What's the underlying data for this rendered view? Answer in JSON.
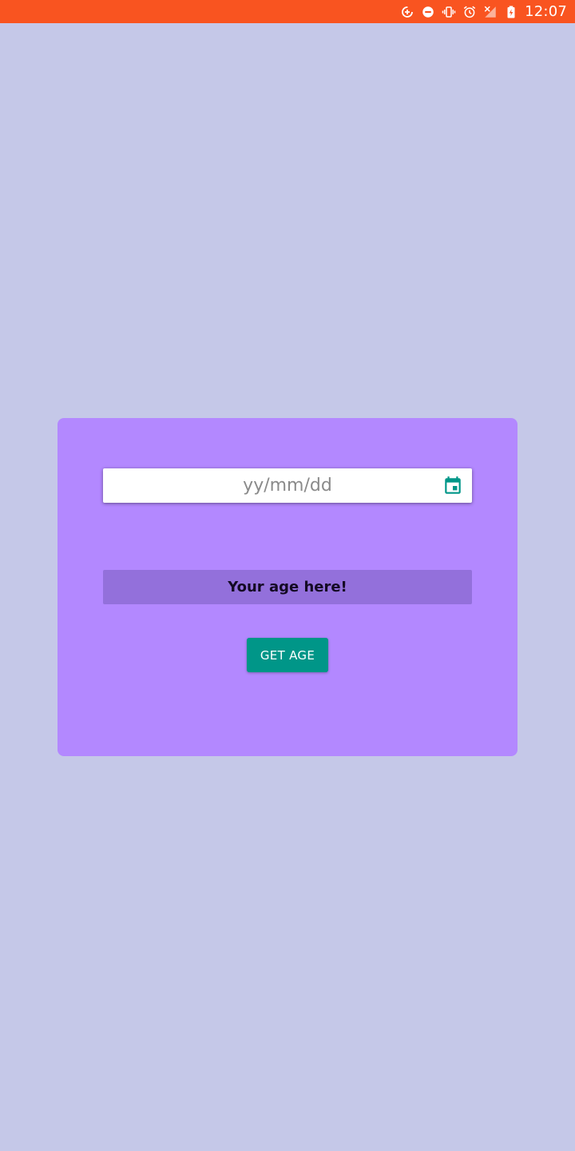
{
  "status_bar": {
    "time": "12:07",
    "icons": [
      "data-saver-icon",
      "do-not-disturb-icon",
      "vibrate-icon",
      "alarm-icon",
      "no-signal-icon",
      "battery-charging-icon"
    ],
    "background_color": "#f95420"
  },
  "form": {
    "date_placeholder": "yy/mm/dd",
    "date_value": "",
    "calendar_icon": "calendar-icon",
    "result_text": "Your age here!",
    "button_label": "GET AGE"
  },
  "colors": {
    "page_background": "#c5c8e8",
    "card_background": "#b388ff",
    "result_background": "#9370db",
    "button_background": "#009688",
    "accent_icon": "#009688"
  }
}
